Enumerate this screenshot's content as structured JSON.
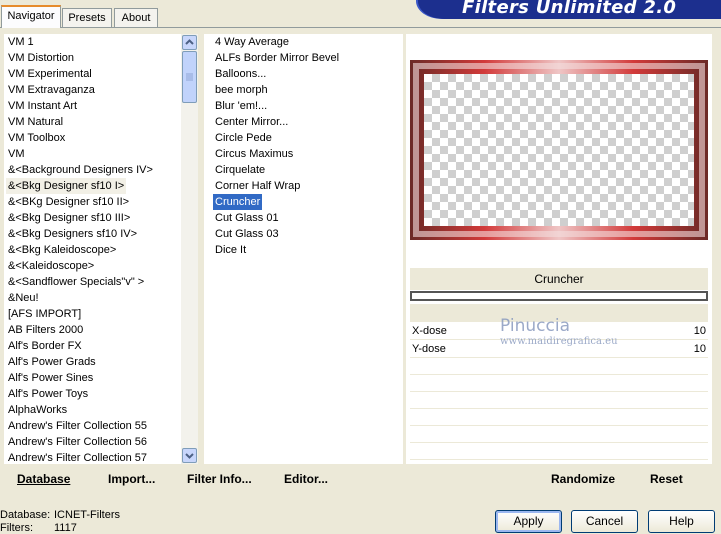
{
  "tabs": [
    "Navigator",
    "Presets",
    "About"
  ],
  "app_title": "Filters Unlimited 2.0",
  "categories": [
    "VM 1",
    "VM Distortion",
    "VM Experimental",
    "VM Extravaganza",
    "VM Instant Art",
    "VM Natural",
    "VM Toolbox",
    "VM",
    "&<Background Designers IV>",
    "&<Bkg Designer sf10 I>",
    "&<BKg Designer sf10 II>",
    "&<Bkg Designer sf10 III>",
    "&<Bkg Designers sf10 IV>",
    "&<Bkg Kaleidoscope>",
    "&<Kaleidoscope>",
    "&<Sandflower Specials\"v\" >",
    "&Neu!",
    "[AFS IMPORT]",
    "AB Filters 2000",
    "Alf's Border FX",
    "Alf's Power Grads",
    "Alf's Power Sines",
    "Alf's Power Toys",
    "AlphaWorks",
    "Andrew's Filter Collection 55",
    "Andrew's Filter Collection 56",
    "Andrew's Filter Collection 57"
  ],
  "selected_category_index": 9,
  "filters": [
    "4 Way Average",
    "ALFs Border Mirror Bevel",
    "Balloons...",
    "bee morph",
    "Blur 'em!...",
    "Center Mirror...",
    "Circle Pede",
    "Circus Maximus",
    "Cirquelate",
    "Corner Half Wrap",
    "Cruncher",
    "Cut Glass  01",
    "Cut Glass  03",
    "Dice It"
  ],
  "selected_filter_index": 10,
  "filter_name": "Cruncher",
  "params": [
    {
      "label": "X-dose",
      "value": "10"
    },
    {
      "label": "Y-dose",
      "value": "10"
    }
  ],
  "watermark": {
    "name": "Pinuccia",
    "url": "www.maidiregrafica.eu"
  },
  "links": {
    "database": "Database",
    "import": "Import...",
    "filter_info": "Filter Info...",
    "editor": "Editor..."
  },
  "actions": {
    "randomize": "Randomize",
    "reset": "Reset"
  },
  "status": {
    "database_label": "Database:",
    "database_value": "ICNET-Filters",
    "filters_label": "Filters:",
    "filters_value": "1117"
  },
  "buttons": {
    "apply": "Apply",
    "cancel": "Cancel",
    "help": "Help"
  },
  "colors": {
    "selection": "#316ac5",
    "banner": "#1c2f8e",
    "frame": "#7c2e2a"
  }
}
